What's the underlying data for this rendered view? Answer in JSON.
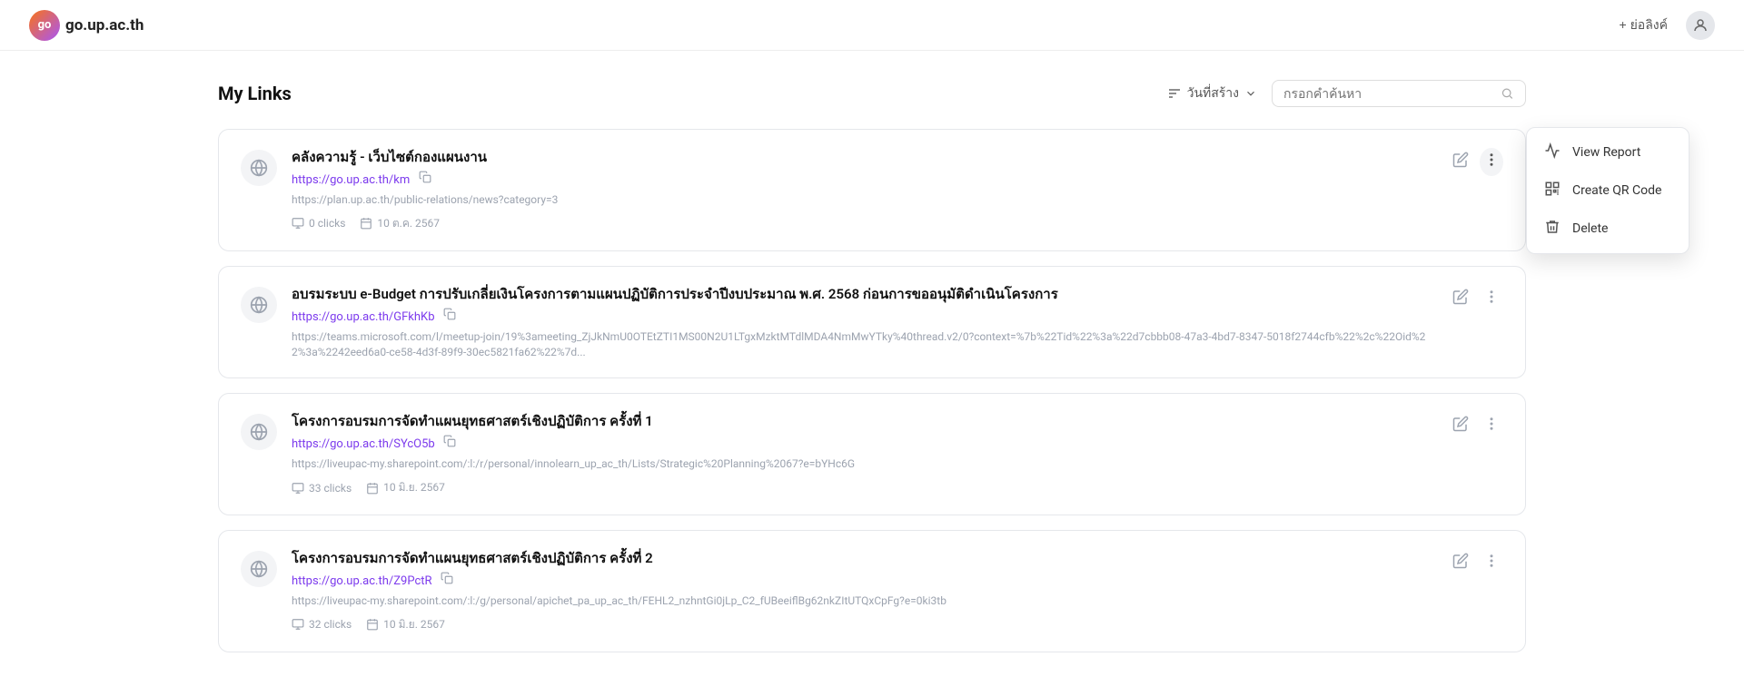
{
  "header": {
    "logo_text": "go.up.ac.th",
    "logo_abbr": "go",
    "create_label": "+ ย่อลิงค์",
    "avatar_icon": "person"
  },
  "toolbar": {
    "page_title": "My Links",
    "sort_label": "วันที่สร้าง",
    "search_placeholder": "กรอกคำค้นหา"
  },
  "links": [
    {
      "id": 1,
      "title": "คลังความรู้ - เว็บไซต์กองแผนงาน",
      "short_url": "https://go.up.ac.th/km",
      "full_url": "https://plan.up.ac.th/public-relations/news?category=3",
      "clicks": "0 clicks",
      "date": "10 ต.ค. 2567",
      "has_dropdown": true
    },
    {
      "id": 2,
      "title": "อบรมระบบ e-Budget การปรับเกลี่ยเงินโครงการตามแผนปฏิบัติการประจำปีงบประมาณ พ.ศ. 2568 ก่อนการขออนุมัติดำเนินโครงการ",
      "short_url": "https://go.up.ac.th/GFkhKb",
      "full_url": "https://teams.microsoft.com/l/meetup-join/19%3ameeting_ZjJkNmU0OTEtZTI1MS00N2U1LTgxMzktMTdlMDA4NmMwYTky%40thread.v2/0?context=%7b%22Tid%22%3a%22d7cbbb08-47a3-4bd7-8347-5018f2744cfb%22%2c%22Oid%22%3a%2242eed6a0-ce58-4d3f-89f9-30ec5821fa62%22%7d...",
      "clicks": null,
      "date": null,
      "has_dropdown": false
    },
    {
      "id": 3,
      "title": "โครงการอบรมการจัดทำแผนยุทธศาสตร์เชิงปฏิบัติการ ครั้งที่ 1",
      "short_url": "https://go.up.ac.th/SYcO5b",
      "full_url": "https://liveupac-my.sharepoint.com/:l:/r/personal/innolearn_up_ac_th/Lists/Strategic%20Planning%2067?e=bYHc6G",
      "clicks": "33 clicks",
      "date": "10 มิ.ย. 2567",
      "has_dropdown": false
    },
    {
      "id": 4,
      "title": "โครงการอบรมการจัดทำแผนยุทธศาสตร์เชิงปฏิบัติการ ครั้งที่ 2",
      "short_url": "https://go.up.ac.th/Z9PctR",
      "full_url": "https://liveupac-my.sharepoint.com/:l:/g/personal/apichet_pa_up_ac_th/FEHL2_nzhntGi0jLp_C2_fUBeeiflBg62nkZItUTQxCpFg?e=0ki3tb",
      "clicks": "32 clicks",
      "date": "10 มิ.ย. 2567",
      "has_dropdown": false
    }
  ],
  "dropdown": {
    "view_report_label": "View Report",
    "create_qr_label": "Create QR Code",
    "delete_label": "Delete"
  }
}
